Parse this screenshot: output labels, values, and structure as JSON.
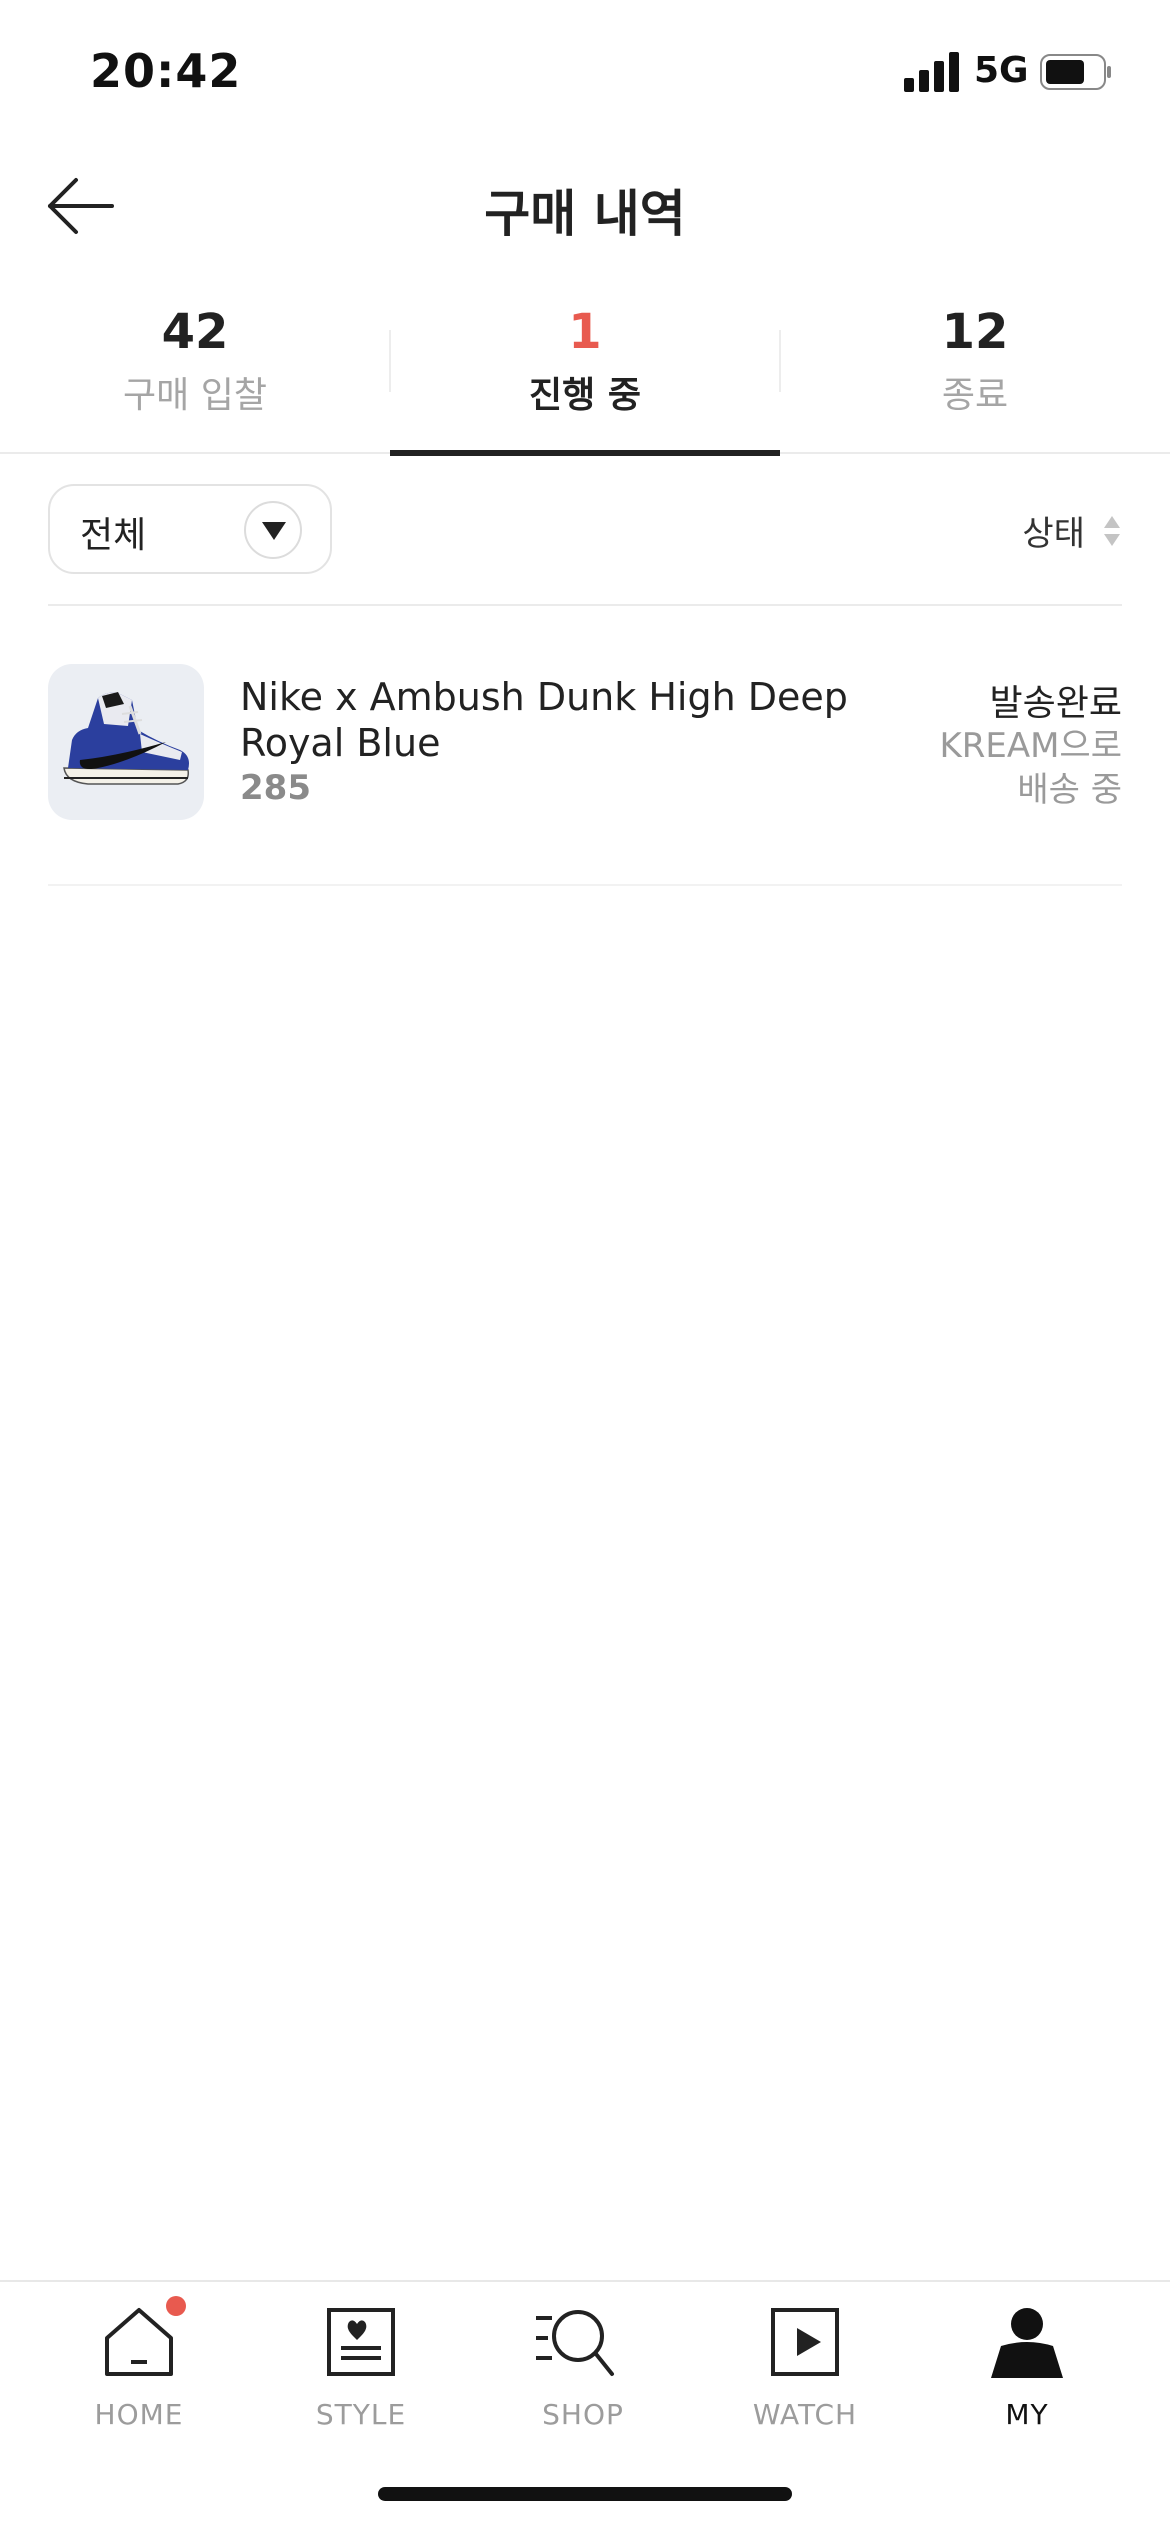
{
  "status_bar": {
    "time": "20:42",
    "network": "5G"
  },
  "header": {
    "title": "구매 내역"
  },
  "tabs": [
    {
      "count": "42",
      "label": "구매 입찰"
    },
    {
      "count": "1",
      "label": "진행 중"
    },
    {
      "count": "12",
      "label": "종료"
    }
  ],
  "active_tab": 1,
  "filter": {
    "label": "전체"
  },
  "sort": {
    "label": "상태"
  },
  "items": [
    {
      "name": "Nike x Ambush Dunk High Deep Royal Blue",
      "size": "285",
      "status": "발송완료",
      "sub_status": "KREAM으로 배송 중"
    }
  ],
  "bottom_nav": [
    {
      "label": "HOME",
      "icon": "home-icon"
    },
    {
      "label": "STYLE",
      "icon": "style-icon"
    },
    {
      "label": "SHOP",
      "icon": "search-icon"
    },
    {
      "label": "WATCH",
      "icon": "play-icon"
    },
    {
      "label": "MY",
      "icon": "person-icon"
    }
  ],
  "colors": {
    "accent": "#e85a4f",
    "text": "#222222",
    "muted": "#9a9a9a"
  }
}
